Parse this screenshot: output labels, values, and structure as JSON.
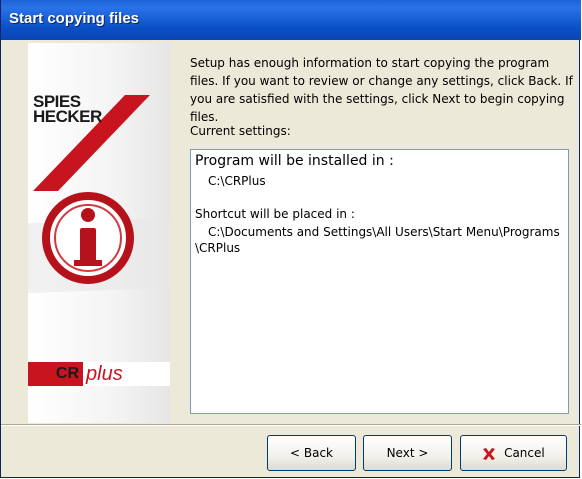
{
  "window": {
    "title": "Start copying files"
  },
  "left_panel": {
    "brand_line1": "SPIES",
    "brand_line2": "HECKER",
    "product_cr": "CR",
    "product_plus": "plus"
  },
  "main": {
    "description": "Setup has enough information to start copying the program files. If you want to review or change any settings, click Back. If you are satisfied with the settings, click Next to begin copying files.",
    "current_settings_label": "Current settings:",
    "settings": {
      "install_heading": "Program will be installed in :",
      "install_path": "C:\\CRPlus",
      "shortcut_heading": "Shortcut will be placed in :",
      "shortcut_path": "C:\\Documents and Settings\\All Users\\Start Menu\\Programs \\CRPlus"
    }
  },
  "buttons": {
    "back_label": "< Back",
    "next_label": "Next >",
    "cancel_label": "Cancel",
    "cancel_icon": "x-icon"
  },
  "colors": {
    "title_bar": "#0b4fc6",
    "brand_red": "#c8141e",
    "dialog_bg": "#ece9d8"
  }
}
